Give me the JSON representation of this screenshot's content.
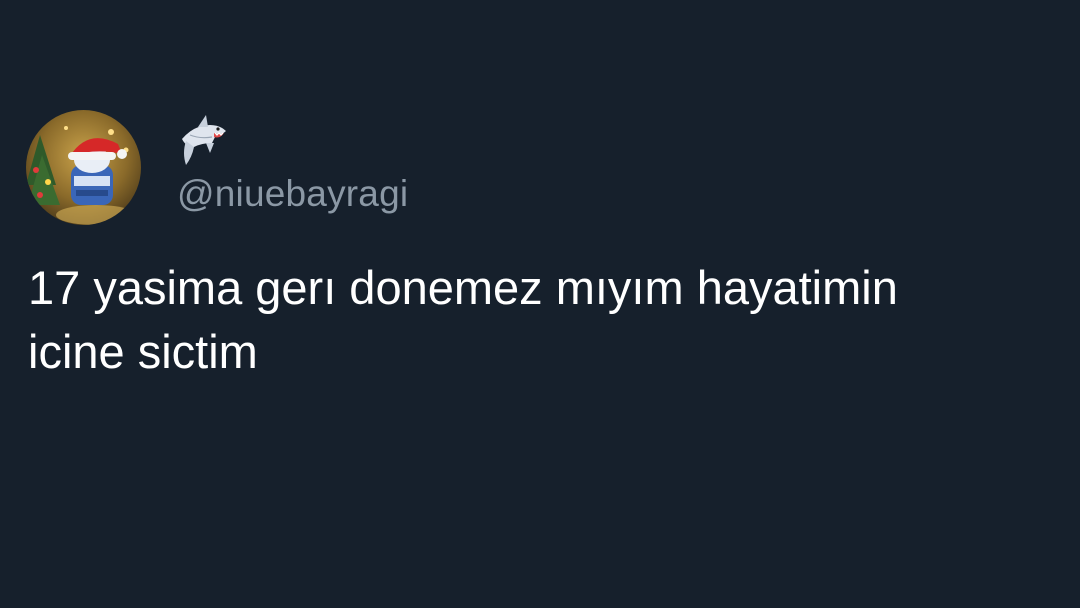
{
  "tweet": {
    "author": {
      "display_name_icon": "shark-emoji-icon",
      "handle": "@niuebayragi",
      "avatar_icon": "avatar-image"
    },
    "text_lines": [
      "17 yasima gerı donemez mıyım hayatimin",
      "icine sictim"
    ]
  },
  "colors": {
    "background": "#16202c",
    "text": "#ffffff",
    "handle": "#8b98a5"
  }
}
